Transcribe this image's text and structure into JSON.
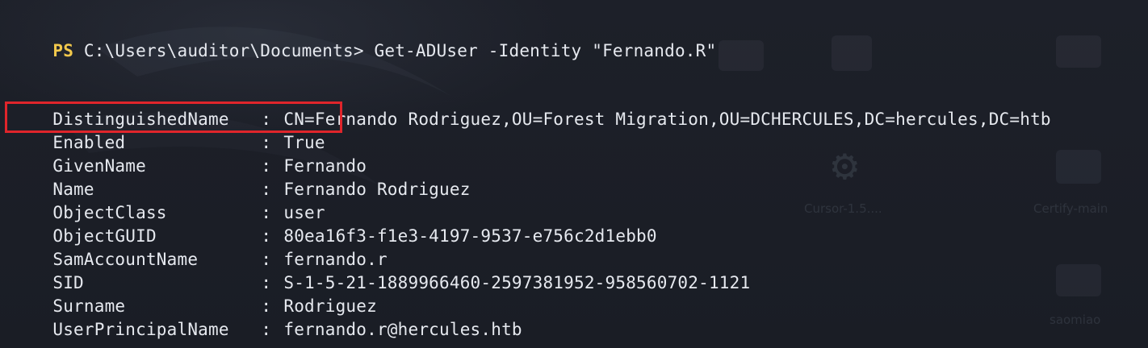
{
  "terminal": {
    "prompt_ps": "PS",
    "prompt_path": "C:\\Users\\auditor\\Documents>",
    "command": "Get-ADUser -Identity \"Fernando.R\"",
    "properties": [
      {
        "name": "DistinguishedName",
        "value": "CN=Fernando Rodriguez,OU=Forest Migration,OU=DCHERCULES,DC=hercules,DC=htb"
      },
      {
        "name": "Enabled",
        "value": "True"
      },
      {
        "name": "GivenName",
        "value": "Fernando"
      },
      {
        "name": "Name",
        "value": "Fernando Rodriguez"
      },
      {
        "name": "ObjectClass",
        "value": "user"
      },
      {
        "name": "ObjectGUID",
        "value": "80ea16f3-f1e3-4197-9537-e756c2d1ebb0"
      },
      {
        "name": "SamAccountName",
        "value": "fernando.r"
      },
      {
        "name": "SID",
        "value": "S-1-5-21-1889966460-2597381952-958560702-1121"
      },
      {
        "name": "Surname",
        "value": "Rodriguez"
      },
      {
        "name": "UserPrincipalName",
        "value": "fernando.r@hercules.htb"
      }
    ],
    "separator": ":",
    "highlighted_property": "Enabled"
  },
  "desktop_background": {
    "icon_labels": [
      "Cursor-1.5....",
      "Certify-main",
      "saomiao"
    ]
  },
  "colors": {
    "background": "#1b1e26",
    "prompt_ps": "#f2c94c",
    "text": "#e6e9ef",
    "highlight_box": "#e0252b"
  }
}
